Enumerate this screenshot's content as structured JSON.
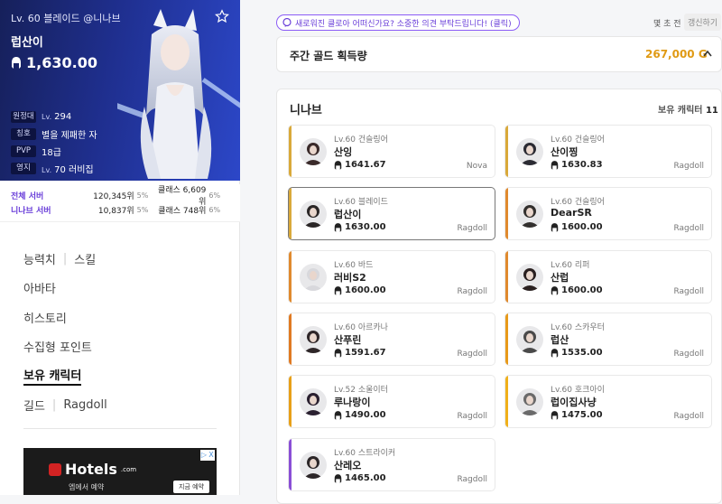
{
  "profile": {
    "header": "Lv. 60 블레이드 @니나브",
    "name": "럽산이",
    "item_level": "1,630.00",
    "stats": [
      {
        "tag": "원정대",
        "lv": "Lv.",
        "value": "294"
      },
      {
        "tag": "칭호",
        "lv": "",
        "value": "별을 제패한 자"
      },
      {
        "tag": "PVP",
        "lv": "",
        "value": "18급"
      },
      {
        "tag": "영지",
        "lv": "Lv.",
        "value": "70 러비집"
      }
    ],
    "ranks": [
      {
        "label": "전체 서버",
        "overall": "120,345위",
        "overall_pct": "5%",
        "class": "클래스 6,609위",
        "class_pct": "6%"
      },
      {
        "label": "니나브 서버",
        "overall": "10,837위",
        "overall_pct": "5%",
        "class": "클래스 748위",
        "class_pct": "6%"
      }
    ]
  },
  "menu": {
    "stats": "능력치",
    "skill": "스킬",
    "avatar": "아바타",
    "history": "히스토리",
    "collection": "수집형 포인트",
    "characters": "보유 캐릭터",
    "guild": "길드",
    "guild_name": "Ragdoll"
  },
  "ad": {
    "brand": "Hotels",
    "brand_suffix": ".com",
    "sub": "엡에서 예약",
    "button": "지금 예약",
    "x": "X"
  },
  "notice": "새로워진 클로아 어떠신가요? 소중한 의견 부탁드립니다! (클릭)",
  "update": {
    "time": "몇 초 전",
    "button": "갱신하기"
  },
  "gold": {
    "title": "주간 골드 획득량",
    "value": "267,000 G"
  },
  "server": {
    "name": "니나브",
    "count_label": "보유 캐릭터",
    "count": "11"
  },
  "characters": [
    {
      "cls": "Lv.60 건슬링어",
      "name": "산잉",
      "ilvl": "1641.67",
      "server": "Nova",
      "color": "#d9a93a"
    },
    {
      "cls": "Lv.60 건슬링어",
      "name": "산이찡",
      "ilvl": "1630.83",
      "server": "Ragdoll",
      "color": "#d9a93a"
    },
    {
      "cls": "Lv.60 블레이드",
      "name": "럽산이",
      "ilvl": "1630.00",
      "server": "Ragdoll",
      "color": "#d9a93a"
    },
    {
      "cls": "Lv.60 건슬링어",
      "name": "DearSR",
      "ilvl": "1600.00",
      "server": "Ragdoll",
      "color": "#e08a2e"
    },
    {
      "cls": "Lv.60 바드",
      "name": "러비S2",
      "ilvl": "1600.00",
      "server": "Ragdoll",
      "color": "#e08a2e"
    },
    {
      "cls": "Lv.60 리퍼",
      "name": "산럽",
      "ilvl": "1600.00",
      "server": "Ragdoll",
      "color": "#e08a2e"
    },
    {
      "cls": "Lv.60 아르카나",
      "name": "산푸린",
      "ilvl": "1591.67",
      "server": "Ragdoll",
      "color": "#e07a22"
    },
    {
      "cls": "Lv.60 스카우터",
      "name": "럽산",
      "ilvl": "1535.00",
      "server": "Ragdoll",
      "color": "#e89a1a"
    },
    {
      "cls": "Lv.52 소울이터",
      "name": "루나랑이",
      "ilvl": "1490.00",
      "server": "Ragdoll",
      "color": "#e8a018"
    },
    {
      "cls": "Lv.60 호크아이",
      "name": "럽이집사냥",
      "ilvl": "1475.00",
      "server": "Ragdoll",
      "color": "#f0b01a"
    },
    {
      "cls": "Lv.60 스트라이커",
      "name": "산레오",
      "ilvl": "1465.00",
      "server": "Ragdoll",
      "color": "#8a4fd6"
    }
  ],
  "colors": {
    "accent": "#6a3fd9",
    "gold": "#e09a14",
    "hero_bg": "#1f2f8f"
  }
}
